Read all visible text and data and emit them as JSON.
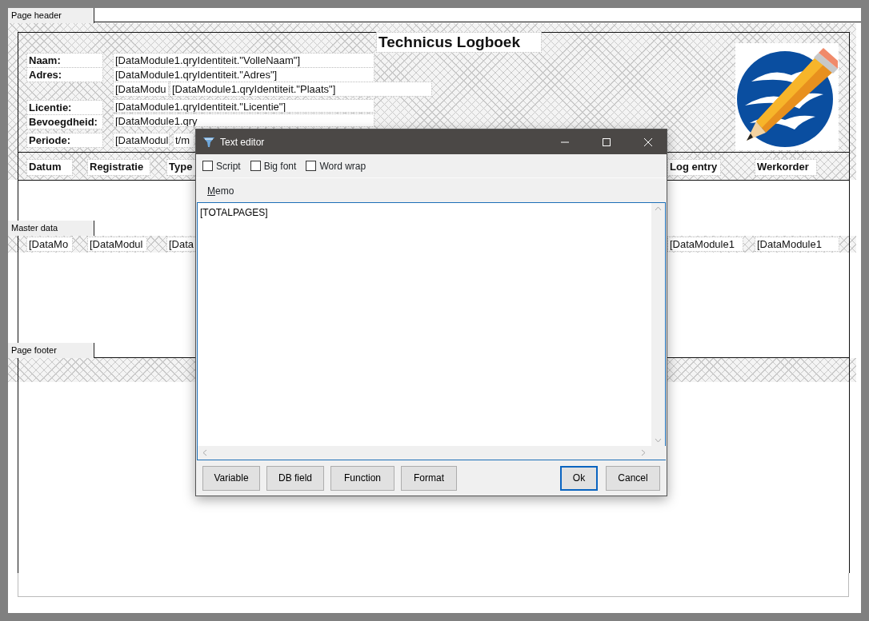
{
  "page_header": {
    "band_label": "Page header",
    "title": "Technicus Logboek",
    "labels": [
      "Naam:",
      "Adres:",
      "Licentie:",
      "Bevoegdheid:",
      "Periode:"
    ],
    "fields": [
      "[DataModule1.qryIdentiteit.\"VolleNaam\"]",
      "[DataModule1.qryIdentiteit.\"Adres\"]",
      "[DataModu",
      "[DataModule1.qryIdentiteit.\"Plaats\"]",
      "[DataModule1.qryIdentiteit.\"Licentie\"]",
      "[DataModule1.qry",
      "[DataModul",
      "t/m"
    ],
    "column_headers": [
      "Datum",
      "Registratie",
      "Type",
      "Log entry",
      "Werkorder"
    ]
  },
  "master_data": {
    "band_label": "Master data",
    "fields": [
      "[DataMo",
      "[DataModul",
      "[Data",
      "[DataModule1",
      "[DataModule1"
    ]
  },
  "page_footer": {
    "band_label": "Page footer"
  },
  "dialog": {
    "title": "Text editor",
    "options": [
      {
        "label": "Script",
        "checked": false
      },
      {
        "label": "Big font",
        "checked": false
      },
      {
        "label": "Word wrap",
        "checked": false
      }
    ],
    "memo_label": "Memo",
    "memo_text": "[TOTALPAGES]",
    "tool_buttons": [
      {
        "label": "Variable"
      },
      {
        "label": "DB field"
      },
      {
        "label": "Function"
      },
      {
        "label": "Format"
      }
    ],
    "action_buttons": [
      {
        "label": "Ok",
        "default": true
      },
      {
        "label": "Cancel",
        "default": false
      }
    ]
  }
}
